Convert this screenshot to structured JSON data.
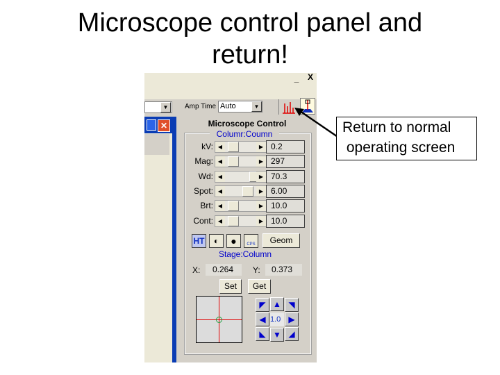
{
  "slide": {
    "title_line1": "Microscope control panel and",
    "title_line2": "return!",
    "callout_line1": "Return to normal",
    "callout_line2": " operating screen"
  },
  "window": {
    "minimize": "_",
    "close": "X"
  },
  "toolbar": {
    "amp_time_label": "Amp Time",
    "amp_time_value": "Auto",
    "spectrum_icon": "spectrum-icon",
    "microscope_icon": "beam-icon"
  },
  "panel": {
    "title": "Microscope Control",
    "column_group": "Columr:Coumn",
    "sliders": [
      {
        "label": "kV:",
        "value": "0.2",
        "position": 0.1
      },
      {
        "label": "Mag:",
        "value": "297",
        "position": 0.1
      },
      {
        "label": "Wd:",
        "value": "70.3",
        "position": 0.85
      },
      {
        "label": "Spot:",
        "value": "6.00",
        "position": 0.6
      },
      {
        "label": "Brt:",
        "value": "10.0",
        "position": 0.1
      },
      {
        "label": "Cont:",
        "value": "10.0",
        "position": 0.1
      }
    ],
    "ht_button": "HT",
    "cps_label": "CPS",
    "geom_button": "Geom",
    "stage_group": "Stage:Column",
    "x_label": "X:",
    "x_value": "0.264",
    "y_label": "Y:",
    "y_value": "0.373",
    "set_button": "Set",
    "get_button": "Get",
    "step_value": "1.0"
  },
  "colors": {
    "panel": "#d4d0c8",
    "group_title": "#0000cc",
    "crosshair": "#e00000",
    "window_blue": "#0a3cb4",
    "close_red": "#e0502a"
  }
}
